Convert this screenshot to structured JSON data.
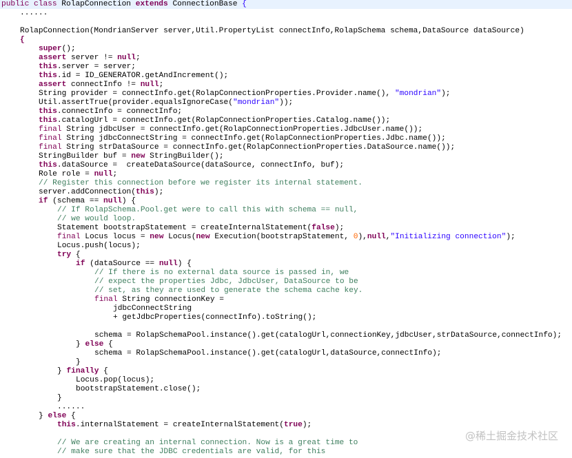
{
  "editor": {
    "lines": [
      {
        "indent": 0,
        "highlight": true,
        "tokens": [
          {
            "t": "mod",
            "v": "public"
          },
          {
            "t": "p",
            "v": " "
          },
          {
            "t": "mod",
            "v": "class"
          },
          {
            "t": "p",
            "v": " RolapConnection "
          },
          {
            "t": "kw",
            "v": "extends"
          },
          {
            "t": "p",
            "v": " ConnectionBase "
          },
          {
            "t": "st",
            "v": "{"
          }
        ]
      },
      {
        "indent": 1,
        "tokens": [
          {
            "t": "p",
            "v": "......"
          }
        ]
      },
      {
        "indent": 0,
        "tokens": []
      },
      {
        "indent": 1,
        "tokens": [
          {
            "t": "p",
            "v": "RolapConnection(MondrianServer server,Util.PropertyList connectInfo,RolapSchema schema,DataSource dataSource)"
          }
        ]
      },
      {
        "indent": 1,
        "tokens": [
          {
            "t": "kw",
            "v": "{"
          }
        ]
      },
      {
        "indent": 2,
        "tokens": [
          {
            "t": "kw",
            "v": "super"
          },
          {
            "t": "p",
            "v": "();"
          }
        ]
      },
      {
        "indent": 2,
        "tokens": [
          {
            "t": "kw",
            "v": "assert"
          },
          {
            "t": "p",
            "v": " server != "
          },
          {
            "t": "kw",
            "v": "null"
          },
          {
            "t": "p",
            "v": ";"
          }
        ]
      },
      {
        "indent": 2,
        "tokens": [
          {
            "t": "kw",
            "v": "this"
          },
          {
            "t": "p",
            "v": ".server = server;"
          }
        ]
      },
      {
        "indent": 2,
        "tokens": [
          {
            "t": "kw",
            "v": "this"
          },
          {
            "t": "p",
            "v": ".id = ID_GENERATOR.getAndIncrement();"
          }
        ]
      },
      {
        "indent": 2,
        "tokens": [
          {
            "t": "kw",
            "v": "assert"
          },
          {
            "t": "p",
            "v": " connectInfo != "
          },
          {
            "t": "kw",
            "v": "null"
          },
          {
            "t": "p",
            "v": ";"
          }
        ]
      },
      {
        "indent": 2,
        "tokens": [
          {
            "t": "p",
            "v": "String provider = connectInfo.get(RolapConnectionProperties.Provider.name(), "
          },
          {
            "t": "st",
            "v": "\"mondrian\""
          },
          {
            "t": "p",
            "v": ");"
          }
        ]
      },
      {
        "indent": 2,
        "tokens": [
          {
            "t": "p",
            "v": "Util.assertTrue(provider.equalsIgnoreCase("
          },
          {
            "t": "st",
            "v": "\"mondrian\""
          },
          {
            "t": "p",
            "v": "));"
          }
        ]
      },
      {
        "indent": 2,
        "tokens": [
          {
            "t": "kw",
            "v": "this"
          },
          {
            "t": "p",
            "v": ".connectInfo = connectInfo;"
          }
        ]
      },
      {
        "indent": 2,
        "tokens": [
          {
            "t": "kw",
            "v": "this"
          },
          {
            "t": "p",
            "v": ".catalogUrl = connectInfo.get(RolapConnectionProperties.Catalog.name());"
          }
        ]
      },
      {
        "indent": 2,
        "tokens": [
          {
            "t": "mod",
            "v": "final"
          },
          {
            "t": "p",
            "v": " String jdbcUser = connectInfo.get(RolapConnectionProperties.JdbcUser.name());"
          }
        ]
      },
      {
        "indent": 2,
        "tokens": [
          {
            "t": "mod",
            "v": "final"
          },
          {
            "t": "p",
            "v": " String jdbcConnectString = connectInfo.get(RolapConnectionProperties.Jdbc.name());"
          }
        ]
      },
      {
        "indent": 2,
        "tokens": [
          {
            "t": "mod",
            "v": "final"
          },
          {
            "t": "p",
            "v": " String strDataSource = connectInfo.get(RolapConnectionProperties.DataSource.name());"
          }
        ]
      },
      {
        "indent": 2,
        "tokens": [
          {
            "t": "p",
            "v": "StringBuilder buf = "
          },
          {
            "t": "kw",
            "v": "new"
          },
          {
            "t": "p",
            "v": " StringBuilder();"
          }
        ]
      },
      {
        "indent": 2,
        "tokens": [
          {
            "t": "kw",
            "v": "this"
          },
          {
            "t": "p",
            "v": ".dataSource =  createDataSource(dataSource, connectInfo, buf);"
          }
        ]
      },
      {
        "indent": 2,
        "tokens": [
          {
            "t": "p",
            "v": "Role role = "
          },
          {
            "t": "kw",
            "v": "null"
          },
          {
            "t": "p",
            "v": ";"
          }
        ]
      },
      {
        "indent": 2,
        "tokens": [
          {
            "t": "cm",
            "v": "// Register this connection before we register its internal statement."
          }
        ]
      },
      {
        "indent": 2,
        "tokens": [
          {
            "t": "p",
            "v": "server.addConnection("
          },
          {
            "t": "kw",
            "v": "this"
          },
          {
            "t": "p",
            "v": ");"
          }
        ]
      },
      {
        "indent": 2,
        "tokens": [
          {
            "t": "kw",
            "v": "if"
          },
          {
            "t": "p",
            "v": " (schema == "
          },
          {
            "t": "kw",
            "v": "null"
          },
          {
            "t": "p",
            "v": ") {"
          }
        ]
      },
      {
        "indent": 3,
        "tokens": [
          {
            "t": "cm",
            "v": "// If RolapSchema.Pool.get were to call this with schema == null,"
          }
        ]
      },
      {
        "indent": 3,
        "tokens": [
          {
            "t": "cm",
            "v": "// we would loop."
          }
        ]
      },
      {
        "indent": 3,
        "tokens": [
          {
            "t": "p",
            "v": "Statement bootstrapStatement = createInternalStatement("
          },
          {
            "t": "kw",
            "v": "false"
          },
          {
            "t": "p",
            "v": ");"
          }
        ]
      },
      {
        "indent": 3,
        "tokens": [
          {
            "t": "mod",
            "v": "final"
          },
          {
            "t": "p",
            "v": " Locus locus = "
          },
          {
            "t": "kw",
            "v": "new"
          },
          {
            "t": "p",
            "v": " Locus("
          },
          {
            "t": "kw",
            "v": "new"
          },
          {
            "t": "p",
            "v": " Execution(bootstrapStatement, "
          },
          {
            "t": "nm",
            "v": "0"
          },
          {
            "t": "p",
            "v": "),"
          },
          {
            "t": "kw",
            "v": "null"
          },
          {
            "t": "p",
            "v": ","
          },
          {
            "t": "st",
            "v": "\"Initializing connection\""
          },
          {
            "t": "p",
            "v": ");"
          }
        ]
      },
      {
        "indent": 3,
        "tokens": [
          {
            "t": "p",
            "v": "Locus.push(locus);"
          }
        ]
      },
      {
        "indent": 3,
        "tokens": [
          {
            "t": "kw",
            "v": "try"
          },
          {
            "t": "p",
            "v": " {"
          }
        ]
      },
      {
        "indent": 4,
        "tokens": [
          {
            "t": "kw",
            "v": "if"
          },
          {
            "t": "p",
            "v": " (dataSource == "
          },
          {
            "t": "kw",
            "v": "null"
          },
          {
            "t": "p",
            "v": ") {"
          }
        ]
      },
      {
        "indent": 5,
        "tokens": [
          {
            "t": "cm",
            "v": "// If there is no external data source is passed in, we"
          }
        ]
      },
      {
        "indent": 5,
        "tokens": [
          {
            "t": "cm",
            "v": "// expect the properties Jdbc, JdbcUser, DataSource to be"
          }
        ]
      },
      {
        "indent": 5,
        "tokens": [
          {
            "t": "cm",
            "v": "// set, as they are used to generate the schema cache key."
          }
        ]
      },
      {
        "indent": 5,
        "tokens": [
          {
            "t": "mod",
            "v": "final"
          },
          {
            "t": "p",
            "v": " String connectionKey ="
          }
        ]
      },
      {
        "indent": 6,
        "tokens": [
          {
            "t": "p",
            "v": "jdbcConnectString"
          }
        ]
      },
      {
        "indent": 6,
        "tokens": [
          {
            "t": "p",
            "v": "+ getJdbcProperties(connectInfo).toString();"
          }
        ]
      },
      {
        "indent": 0,
        "tokens": []
      },
      {
        "indent": 5,
        "tokens": [
          {
            "t": "p",
            "v": "schema = RolapSchemaPool.instance().get(catalogUrl,connectionKey,jdbcUser,strDataSource,connectInfo);"
          }
        ]
      },
      {
        "indent": 4,
        "tokens": [
          {
            "t": "p",
            "v": "} "
          },
          {
            "t": "kw",
            "v": "else"
          },
          {
            "t": "p",
            "v": " {"
          }
        ]
      },
      {
        "indent": 5,
        "tokens": [
          {
            "t": "p",
            "v": "schema = RolapSchemaPool.instance().get(catalogUrl,dataSource,connectInfo);"
          }
        ]
      },
      {
        "indent": 4,
        "tokens": [
          {
            "t": "p",
            "v": "}"
          }
        ]
      },
      {
        "indent": 3,
        "tokens": [
          {
            "t": "p",
            "v": "} "
          },
          {
            "t": "kw",
            "v": "finally"
          },
          {
            "t": "p",
            "v": " {"
          }
        ]
      },
      {
        "indent": 4,
        "tokens": [
          {
            "t": "p",
            "v": "Locus.pop(locus);"
          }
        ]
      },
      {
        "indent": 4,
        "tokens": [
          {
            "t": "p",
            "v": "bootstrapStatement.close();"
          }
        ]
      },
      {
        "indent": 3,
        "tokens": [
          {
            "t": "p",
            "v": "}"
          }
        ]
      },
      {
        "indent": 3,
        "tokens": [
          {
            "t": "p",
            "v": "......"
          }
        ]
      },
      {
        "indent": 2,
        "tokens": [
          {
            "t": "p",
            "v": "} "
          },
          {
            "t": "kw",
            "v": "else"
          },
          {
            "t": "p",
            "v": " {"
          }
        ]
      },
      {
        "indent": 3,
        "tokens": [
          {
            "t": "kw",
            "v": "this"
          },
          {
            "t": "p",
            "v": ".internalStatement = createInternalStatement("
          },
          {
            "t": "kw",
            "v": "true"
          },
          {
            "t": "p",
            "v": ");"
          }
        ]
      },
      {
        "indent": 0,
        "tokens": []
      },
      {
        "indent": 3,
        "tokens": [
          {
            "t": "cm",
            "v": "// We are creating an internal connection. Now is a great time to"
          }
        ]
      },
      {
        "indent": 3,
        "tokens": [
          {
            "t": "cm",
            "v": "// make sure that the JDBC credentials are valid, for this"
          }
        ]
      }
    ]
  },
  "watermark": {
    "text": "@稀土掘金技术社区"
  }
}
